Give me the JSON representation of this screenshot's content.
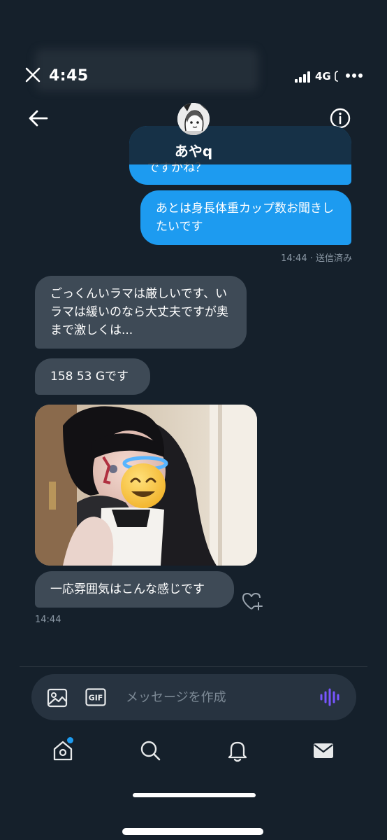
{
  "status_bar": {
    "time": "4:45",
    "network": "4G",
    "dismiss_icon": "close-icon",
    "signal_icon": "cellular-signal-icon",
    "more_icon": "more-dots-icon"
  },
  "header": {
    "name": "あやq",
    "back_icon": "arrow-left-icon",
    "info_icon": "info-circle-icon",
    "avatar_icon": "manga-avatar-icon"
  },
  "messages": [
    {
      "direction": "sent",
      "text": "ですかね？",
      "partially_hidden": true
    },
    {
      "direction": "sent",
      "text": "あとは身長体重カップ数お聞きしたいです"
    },
    {
      "direction": "received",
      "text": "ごっくんいラマは厳しいです、いラマは緩いのなら大丈夫ですが奥まで激しくは..."
    },
    {
      "direction": "received",
      "text": "158 53 Gです"
    },
    {
      "direction": "received",
      "type": "photo",
      "overlay_emoji": "smiling-face-with-halo"
    },
    {
      "direction": "received",
      "text": "一応雰囲気はこんな感じです"
    }
  ],
  "sent_meta": "14:44 · 送信済み",
  "last_time": "14:44",
  "like_icon": "heart-plus-icon",
  "composer": {
    "placeholder": "メッセージを作成",
    "image_icon": "image-icon",
    "gif_label": "GIF",
    "voice_icon": "voice-wave-icon"
  },
  "tabbar": {
    "items": [
      "home-icon",
      "search-icon",
      "bell-icon",
      "mail-icon"
    ],
    "active": "mail-icon"
  },
  "colors": {
    "background": "#15202b",
    "sent_bubble": "#1d9bf0",
    "received_bubble": "#3e4a56",
    "composer": "#273340",
    "voice_accent": "#7856ff",
    "meta_text": "#8b98a5"
  }
}
